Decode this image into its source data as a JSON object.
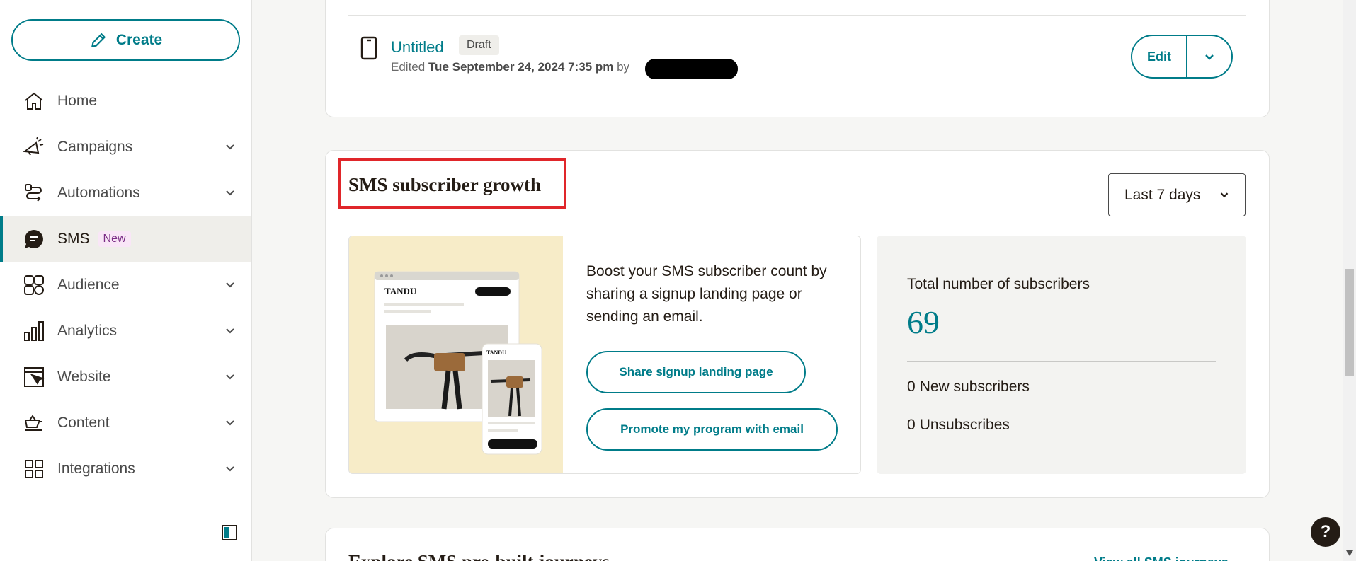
{
  "sidebar": {
    "create_label": "Create",
    "items": [
      {
        "label": "Home",
        "icon": "home-icon"
      },
      {
        "label": "Campaigns",
        "icon": "megaphone-icon"
      },
      {
        "label": "Automations",
        "icon": "automation-icon"
      },
      {
        "label": "SMS",
        "icon": "sms-icon",
        "badge": "New"
      },
      {
        "label": "Audience",
        "icon": "audience-icon"
      },
      {
        "label": "Analytics",
        "icon": "bar-chart-icon"
      },
      {
        "label": "Website",
        "icon": "website-icon"
      },
      {
        "label": "Content",
        "icon": "content-icon"
      },
      {
        "label": "Integrations",
        "icon": "grid-icon"
      }
    ]
  },
  "draft": {
    "title": "Untitled",
    "status": "Draft",
    "edited_prefix": "Edited",
    "edited_date": "Tue September 24, 2024 7:35 pm",
    "edited_by": "by",
    "edit_label": "Edit"
  },
  "sms_growth": {
    "title": "SMS subscriber growth",
    "range": "Last 7 days",
    "promo_text": "Boost your SMS subscriber count by sharing a signup landing page or sending an email.",
    "promo_brand_large": "TANDU",
    "promo_brand_small": "TANDU",
    "share_button": "Share signup landing page",
    "promote_button": "Promote my program with email",
    "total_label": "Total number of subscribers",
    "total_value": "69",
    "new_count": "0",
    "new_label": "New subscribers",
    "unsub_count": "0",
    "unsub_label": "Unsubscribes"
  },
  "explore": {
    "title": "Explore SMS pre-built journeys",
    "link": "View all SMS journeys"
  },
  "help_label": "?",
  "colors": {
    "accent": "#007c89",
    "highlight_box": "#e0262a",
    "promo_bg": "#f7ecc8"
  }
}
